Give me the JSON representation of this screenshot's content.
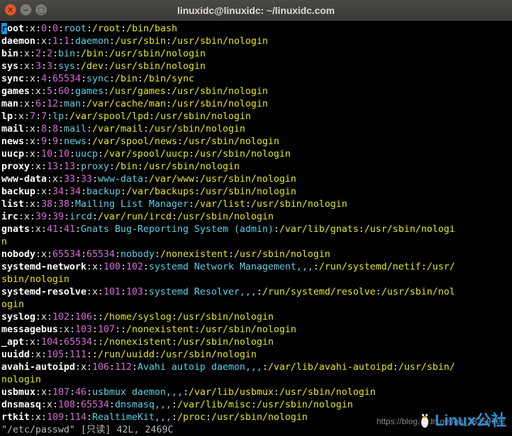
{
  "window": {
    "title": "linuxidc@linuxidc: ~/linuxidc.com",
    "close_glyph": "✕",
    "min_glyph": "−",
    "max_glyph": "□"
  },
  "terminal": {
    "lines": [
      [
        [
          "u",
          "root"
        ],
        [
          ":"
        ],
        [
          "x",
          "x"
        ],
        [
          ":"
        ],
        [
          "id",
          "0"
        ],
        [
          ":"
        ],
        [
          "id",
          "0"
        ],
        [
          ":"
        ],
        [
          "gecos",
          "root"
        ],
        [
          ":"
        ],
        [
          "path",
          "/root"
        ],
        [
          ":"
        ],
        [
          "path",
          "/bin/bash"
        ]
      ],
      [
        [
          "u",
          "daemon"
        ],
        [
          ":"
        ],
        [
          "x",
          "x"
        ],
        [
          ":"
        ],
        [
          "id",
          "1"
        ],
        [
          ":"
        ],
        [
          "id",
          "1"
        ],
        [
          ":"
        ],
        [
          "gecos",
          "daemon"
        ],
        [
          ":"
        ],
        [
          "path",
          "/usr/sbin"
        ],
        [
          ":"
        ],
        [
          "path",
          "/usr/sbin/nologin"
        ]
      ],
      [
        [
          "u",
          "bin"
        ],
        [
          ":"
        ],
        [
          "x",
          "x"
        ],
        [
          ":"
        ],
        [
          "id",
          "2"
        ],
        [
          ":"
        ],
        [
          "id",
          "2"
        ],
        [
          ":"
        ],
        [
          "gecos",
          "bin"
        ],
        [
          ":"
        ],
        [
          "path",
          "/bin"
        ],
        [
          ":"
        ],
        [
          "path",
          "/usr/sbin/nologin"
        ]
      ],
      [
        [
          "u",
          "sys"
        ],
        [
          ":"
        ],
        [
          "x",
          "x"
        ],
        [
          ":"
        ],
        [
          "id",
          "3"
        ],
        [
          ":"
        ],
        [
          "id",
          "3"
        ],
        [
          ":"
        ],
        [
          "gecos",
          "sys"
        ],
        [
          ":"
        ],
        [
          "path",
          "/dev"
        ],
        [
          ":"
        ],
        [
          "path",
          "/usr/sbin/nologin"
        ]
      ],
      [
        [
          "u",
          "sync"
        ],
        [
          ":"
        ],
        [
          "x",
          "x"
        ],
        [
          ":"
        ],
        [
          "id",
          "4"
        ],
        [
          ":"
        ],
        [
          "id",
          "65534"
        ],
        [
          ":"
        ],
        [
          "gecos",
          "sync"
        ],
        [
          ":"
        ],
        [
          "path",
          "/bin"
        ],
        [
          ":"
        ],
        [
          "path",
          "/bin/sync"
        ]
      ],
      [
        [
          "u",
          "games"
        ],
        [
          ":"
        ],
        [
          "x",
          "x"
        ],
        [
          ":"
        ],
        [
          "id",
          "5"
        ],
        [
          ":"
        ],
        [
          "id",
          "60"
        ],
        [
          ":"
        ],
        [
          "gecos",
          "games"
        ],
        [
          ":"
        ],
        [
          "path",
          "/usr/games"
        ],
        [
          ":"
        ],
        [
          "path",
          "/usr/sbin/nologin"
        ]
      ],
      [
        [
          "u",
          "man"
        ],
        [
          ":"
        ],
        [
          "x",
          "x"
        ],
        [
          ":"
        ],
        [
          "id",
          "6"
        ],
        [
          ":"
        ],
        [
          "id",
          "12"
        ],
        [
          ":"
        ],
        [
          "gecos",
          "man"
        ],
        [
          ":"
        ],
        [
          "path",
          "/var/cache/man"
        ],
        [
          ":"
        ],
        [
          "path",
          "/usr/sbin/nologin"
        ]
      ],
      [
        [
          "u",
          "lp"
        ],
        [
          ":"
        ],
        [
          "x",
          "x"
        ],
        [
          ":"
        ],
        [
          "id",
          "7"
        ],
        [
          ":"
        ],
        [
          "id",
          "7"
        ],
        [
          ":"
        ],
        [
          "gecos",
          "lp"
        ],
        [
          ":"
        ],
        [
          "path",
          "/var/spool/lpd"
        ],
        [
          ":"
        ],
        [
          "path",
          "/usr/sbin/nologin"
        ]
      ],
      [
        [
          "u",
          "mail"
        ],
        [
          ":"
        ],
        [
          "x",
          "x"
        ],
        [
          ":"
        ],
        [
          "id",
          "8"
        ],
        [
          ":"
        ],
        [
          "id",
          "8"
        ],
        [
          ":"
        ],
        [
          "gecos",
          "mail"
        ],
        [
          ":"
        ],
        [
          "path",
          "/var/mail"
        ],
        [
          ":"
        ],
        [
          "path",
          "/usr/sbin/nologin"
        ]
      ],
      [
        [
          "u",
          "news"
        ],
        [
          ":"
        ],
        [
          "x",
          "x"
        ],
        [
          ":"
        ],
        [
          "id",
          "9"
        ],
        [
          ":"
        ],
        [
          "id",
          "9"
        ],
        [
          ":"
        ],
        [
          "gecos",
          "news"
        ],
        [
          ":"
        ],
        [
          "path",
          "/var/spool/news"
        ],
        [
          ":"
        ],
        [
          "path",
          "/usr/sbin/nologin"
        ]
      ],
      [
        [
          "u",
          "uucp"
        ],
        [
          ":"
        ],
        [
          "x",
          "x"
        ],
        [
          ":"
        ],
        [
          "id",
          "10"
        ],
        [
          ":"
        ],
        [
          "id",
          "10"
        ],
        [
          ":"
        ],
        [
          "gecos",
          "uucp"
        ],
        [
          ":"
        ],
        [
          "path",
          "/var/spool/uucp"
        ],
        [
          ":"
        ],
        [
          "path",
          "/usr/sbin/nologin"
        ]
      ],
      [
        [
          "u",
          "proxy"
        ],
        [
          ":"
        ],
        [
          "x",
          "x"
        ],
        [
          ":"
        ],
        [
          "id",
          "13"
        ],
        [
          ":"
        ],
        [
          "id",
          "13"
        ],
        [
          ":"
        ],
        [
          "gecos",
          "proxy"
        ],
        [
          ":"
        ],
        [
          "path",
          "/bin"
        ],
        [
          ":"
        ],
        [
          "path",
          "/usr/sbin/nologin"
        ]
      ],
      [
        [
          "u",
          "www-data"
        ],
        [
          ":"
        ],
        [
          "x",
          "x"
        ],
        [
          ":"
        ],
        [
          "id",
          "33"
        ],
        [
          ":"
        ],
        [
          "id",
          "33"
        ],
        [
          ":"
        ],
        [
          "gecos",
          "www-data"
        ],
        [
          ":"
        ],
        [
          "path",
          "/var/www"
        ],
        [
          ":"
        ],
        [
          "path",
          "/usr/sbin/nologin"
        ]
      ],
      [
        [
          "u",
          "backup"
        ],
        [
          ":"
        ],
        [
          "x",
          "x"
        ],
        [
          ":"
        ],
        [
          "id",
          "34"
        ],
        [
          ":"
        ],
        [
          "id",
          "34"
        ],
        [
          ":"
        ],
        [
          "gecos",
          "backup"
        ],
        [
          ":"
        ],
        [
          "path",
          "/var/backups"
        ],
        [
          ":"
        ],
        [
          "path",
          "/usr/sbin/nologin"
        ]
      ],
      [
        [
          "u",
          "list"
        ],
        [
          ":"
        ],
        [
          "x",
          "x"
        ],
        [
          ":"
        ],
        [
          "id",
          "38"
        ],
        [
          ":"
        ],
        [
          "id",
          "38"
        ],
        [
          ":"
        ],
        [
          "gecos",
          "Mailing List Manager"
        ],
        [
          ":"
        ],
        [
          "path",
          "/var/list"
        ],
        [
          ":"
        ],
        [
          "path",
          "/usr/sbin/nologin"
        ]
      ],
      [
        [
          "u",
          "irc"
        ],
        [
          ":"
        ],
        [
          "x",
          "x"
        ],
        [
          ":"
        ],
        [
          "id",
          "39"
        ],
        [
          ":"
        ],
        [
          "id",
          "39"
        ],
        [
          ":"
        ],
        [
          "gecos",
          "ircd"
        ],
        [
          ":"
        ],
        [
          "path",
          "/var/run/ircd"
        ],
        [
          ":"
        ],
        [
          "path",
          "/usr/sbin/nologin"
        ]
      ],
      [
        [
          "u",
          "gnats"
        ],
        [
          ":"
        ],
        [
          "x",
          "x"
        ],
        [
          ":"
        ],
        [
          "id",
          "41"
        ],
        [
          ":"
        ],
        [
          "id",
          "41"
        ],
        [
          ":"
        ],
        [
          "gecos",
          "Gnats Bug-Reporting System (admin)"
        ],
        [
          ":"
        ],
        [
          "path",
          "/var/lib/gnats"
        ],
        [
          ":"
        ],
        [
          "path",
          "/usr/sbin/nologi"
        ]
      ],
      [
        [
          "path",
          "n"
        ]
      ],
      [
        [
          "u",
          "nobody"
        ],
        [
          ":"
        ],
        [
          "x",
          "x"
        ],
        [
          ":"
        ],
        [
          "id",
          "65534"
        ],
        [
          ":"
        ],
        [
          "id",
          "65534"
        ],
        [
          ":"
        ],
        [
          "gecos",
          "nobody"
        ],
        [
          ":"
        ],
        [
          "path",
          "/nonexistent"
        ],
        [
          ":"
        ],
        [
          "path",
          "/usr/sbin/nologin"
        ]
      ],
      [
        [
          "u",
          "systemd-network"
        ],
        [
          ":"
        ],
        [
          "x",
          "x"
        ],
        [
          ":"
        ],
        [
          "id",
          "100"
        ],
        [
          ":"
        ],
        [
          "id",
          "102"
        ],
        [
          ":"
        ],
        [
          "gecos",
          "systemd Network Management,,,"
        ],
        [
          ":"
        ],
        [
          "path",
          "/run/systemd/netif"
        ],
        [
          ":"
        ],
        [
          "path",
          "/usr/"
        ]
      ],
      [
        [
          "path",
          "sbin/nologin"
        ]
      ],
      [
        [
          "u",
          "systemd-resolve"
        ],
        [
          ":"
        ],
        [
          "x",
          "x"
        ],
        [
          ":"
        ],
        [
          "id",
          "101"
        ],
        [
          ":"
        ],
        [
          "id",
          "103"
        ],
        [
          ":"
        ],
        [
          "gecos",
          "systemd Resolver,,,"
        ],
        [
          ":"
        ],
        [
          "path",
          "/run/systemd/resolve"
        ],
        [
          ":"
        ],
        [
          "path",
          "/usr/sbin/nol"
        ]
      ],
      [
        [
          "path",
          "ogin"
        ]
      ],
      [
        [
          "u",
          "syslog"
        ],
        [
          ":"
        ],
        [
          "x",
          "x"
        ],
        [
          ":"
        ],
        [
          "id",
          "102"
        ],
        [
          ":"
        ],
        [
          "id",
          "106"
        ],
        [
          ":"
        ],
        [
          ":"
        ],
        [
          "path",
          "/home/syslog"
        ],
        [
          ":"
        ],
        [
          "path",
          "/usr/sbin/nologin"
        ]
      ],
      [
        [
          "u",
          "messagebus"
        ],
        [
          ":"
        ],
        [
          "x",
          "x"
        ],
        [
          ":"
        ],
        [
          "id",
          "103"
        ],
        [
          ":"
        ],
        [
          "id",
          "107"
        ],
        [
          ":"
        ],
        [
          ":"
        ],
        [
          "path",
          "/nonexistent"
        ],
        [
          ":"
        ],
        [
          "path",
          "/usr/sbin/nologin"
        ]
      ],
      [
        [
          "u",
          "_apt"
        ],
        [
          ":"
        ],
        [
          "x",
          "x"
        ],
        [
          ":"
        ],
        [
          "id",
          "104"
        ],
        [
          ":"
        ],
        [
          "id",
          "65534"
        ],
        [
          ":"
        ],
        [
          ":"
        ],
        [
          "path",
          "/nonexistent"
        ],
        [
          ":"
        ],
        [
          "path",
          "/usr/sbin/nologin"
        ]
      ],
      [
        [
          "u",
          "uuidd"
        ],
        [
          ":"
        ],
        [
          "x",
          "x"
        ],
        [
          ":"
        ],
        [
          "id",
          "105"
        ],
        [
          ":"
        ],
        [
          "id",
          "111"
        ],
        [
          ":"
        ],
        [
          ":"
        ],
        [
          "path",
          "/run/uuidd"
        ],
        [
          ":"
        ],
        [
          "path",
          "/usr/sbin/nologin"
        ]
      ],
      [
        [
          "u",
          "avahi-autoipd"
        ],
        [
          ":"
        ],
        [
          "x",
          "x"
        ],
        [
          ":"
        ],
        [
          "id",
          "106"
        ],
        [
          ":"
        ],
        [
          "id",
          "112"
        ],
        [
          ":"
        ],
        [
          "gecos",
          "Avahi autoip daemon,,,"
        ],
        [
          ":"
        ],
        [
          "path",
          "/var/lib/avahi-autoipd"
        ],
        [
          ":"
        ],
        [
          "path",
          "/usr/sbin/"
        ]
      ],
      [
        [
          "path",
          "nologin"
        ]
      ],
      [
        [
          "u",
          "usbmux"
        ],
        [
          ":"
        ],
        [
          "x",
          "x"
        ],
        [
          ":"
        ],
        [
          "id",
          "107"
        ],
        [
          ":"
        ],
        [
          "id",
          "46"
        ],
        [
          ":"
        ],
        [
          "gecos",
          "usbmux daemon,,,"
        ],
        [
          ":"
        ],
        [
          "path",
          "/var/lib/usbmux"
        ],
        [
          ":"
        ],
        [
          "path",
          "/usr/sbin/nologin"
        ]
      ],
      [
        [
          "u",
          "dnsmasq"
        ],
        [
          ":"
        ],
        [
          "x",
          "x"
        ],
        [
          ":"
        ],
        [
          "id",
          "108"
        ],
        [
          ":"
        ],
        [
          "id",
          "65534"
        ],
        [
          ":"
        ],
        [
          "gecos",
          "dnsmasq,,,"
        ],
        [
          ":"
        ],
        [
          "path",
          "/var/lib/misc"
        ],
        [
          ":"
        ],
        [
          "path",
          "/usr/sbin/nologin"
        ]
      ],
      [
        [
          "u",
          "rtkit"
        ],
        [
          ":"
        ],
        [
          "x",
          "x"
        ],
        [
          ":"
        ],
        [
          "id",
          "109"
        ],
        [
          ":"
        ],
        [
          "id",
          "114"
        ],
        [
          ":"
        ],
        [
          "gecos",
          "RealtimeKit,,,"
        ],
        [
          ":"
        ],
        [
          "path",
          "/proc"
        ],
        [
          ":"
        ],
        [
          "path",
          "/usr/sbin/nologin"
        ]
      ]
    ],
    "status_line": "\"/etc/passwd\" [只读] 42L, 2469C"
  },
  "watermark": {
    "url": "https://blog.csdn.net/qq_38359702",
    "brand": "Linux公社",
    "brand_url": "www.Linuxidc.com"
  },
  "colors": {
    "username": "#ffffff",
    "id": "#d86ad8",
    "path": "#e6e61e",
    "gecos": "#5ed0e6",
    "cursor": "#00a0ff",
    "close_button": "#e95420"
  }
}
